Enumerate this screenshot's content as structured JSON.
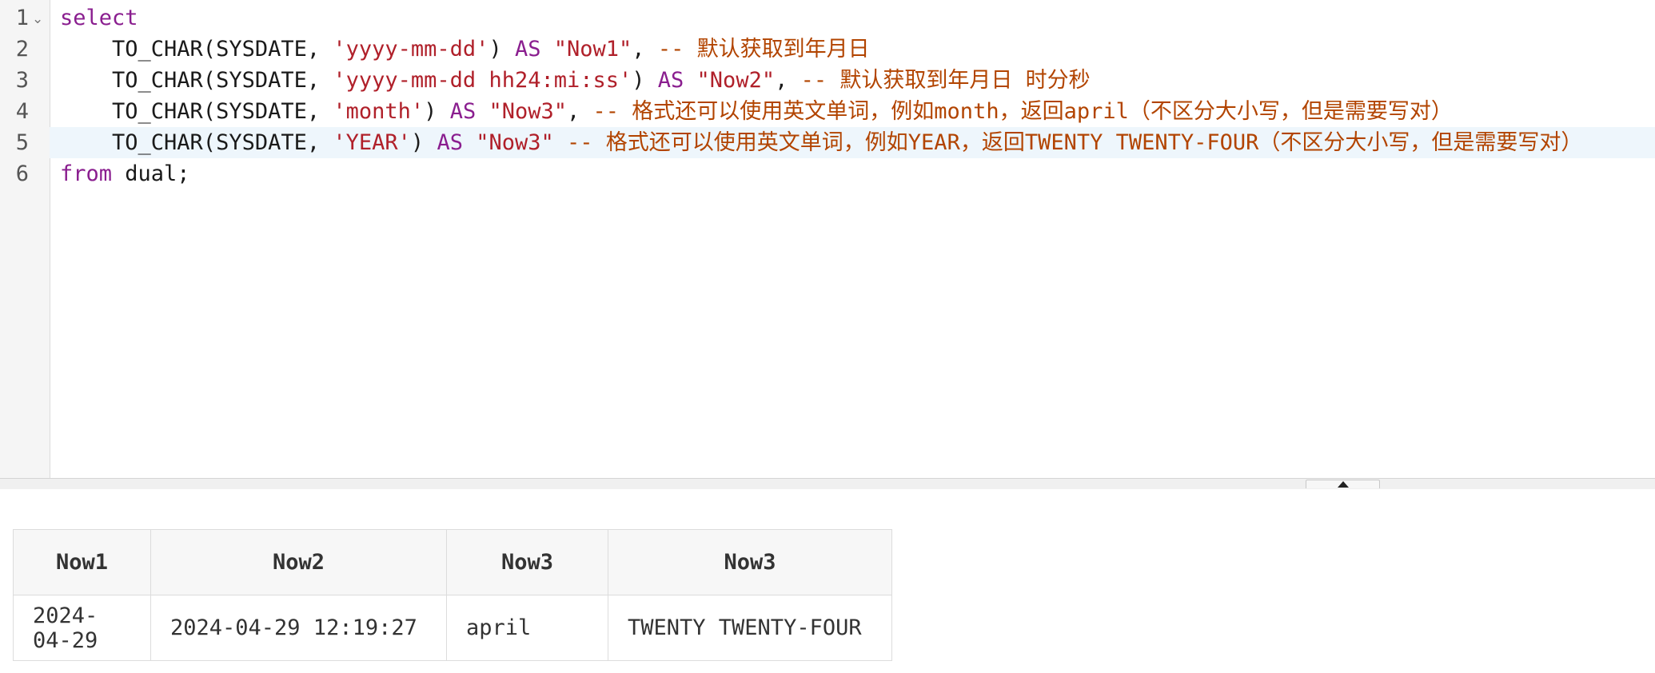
{
  "editor": {
    "line_numbers": [
      "1",
      "2",
      "3",
      "4",
      "5",
      "6"
    ],
    "fold_marker": "⌄",
    "active_line": 5,
    "lines": [
      [
        {
          "t": "kw",
          "v": "select"
        }
      ],
      [
        {
          "t": "pl",
          "v": "    TO_CHAR(SYSDATE, "
        },
        {
          "t": "str",
          "v": "'yyyy-mm-dd'"
        },
        {
          "t": "pl",
          "v": ") "
        },
        {
          "t": "kw",
          "v": "AS"
        },
        {
          "t": "pl",
          "v": " "
        },
        {
          "t": "str",
          "v": "\"Now1\""
        },
        {
          "t": "pl",
          "v": ", "
        },
        {
          "t": "cm",
          "v": "-- 默认获取到年月日"
        }
      ],
      [
        {
          "t": "pl",
          "v": "    TO_CHAR(SYSDATE, "
        },
        {
          "t": "str",
          "v": "'yyyy-mm-dd hh24:mi:ss'"
        },
        {
          "t": "pl",
          "v": ") "
        },
        {
          "t": "kw",
          "v": "AS"
        },
        {
          "t": "pl",
          "v": " "
        },
        {
          "t": "str",
          "v": "\"Now2\""
        },
        {
          "t": "pl",
          "v": ", "
        },
        {
          "t": "cm",
          "v": "-- 默认获取到年月日 时分秒"
        }
      ],
      [
        {
          "t": "pl",
          "v": "    TO_CHAR(SYSDATE, "
        },
        {
          "t": "str",
          "v": "'month'"
        },
        {
          "t": "pl",
          "v": ") "
        },
        {
          "t": "kw",
          "v": "AS"
        },
        {
          "t": "pl",
          "v": " "
        },
        {
          "t": "str",
          "v": "\"Now3\""
        },
        {
          "t": "pl",
          "v": ", "
        },
        {
          "t": "cm",
          "v": "-- 格式还可以使用英文单词，例如month，返回april（不区分大小写，但是需要写对）"
        }
      ],
      [
        {
          "t": "pl",
          "v": "    TO_CHAR(SYSDATE, "
        },
        {
          "t": "str",
          "v": "'YEAR'"
        },
        {
          "t": "pl",
          "v": ") "
        },
        {
          "t": "kw",
          "v": "AS"
        },
        {
          "t": "pl",
          "v": " "
        },
        {
          "t": "str",
          "v": "\"Now3\""
        },
        {
          "t": "pl",
          "v": " "
        },
        {
          "t": "cm",
          "v": "-- 格式还可以使用英文单词，例如YEAR，返回TWENTY TWENTY-FOUR（不区分大小写，但是需要写对）"
        }
      ],
      [
        {
          "t": "kw",
          "v": "from"
        },
        {
          "t": "pl",
          "v": " dual;"
        }
      ]
    ]
  },
  "results": {
    "columns": [
      "Now1",
      "Now2",
      "Now3",
      "Now3"
    ],
    "rows": [
      [
        "2024-04-29",
        "2024-04-29 12:19:27",
        "april",
        "TWENTY TWENTY-FOUR"
      ]
    ]
  },
  "colors": {
    "keyword": "#8a1e8f",
    "string": "#b0202a",
    "comment": "#b24400",
    "active_line_bg": "#eef6fc"
  },
  "icons": {
    "fold": "chevron-down-icon",
    "splitter": "triangle-up-icon"
  }
}
